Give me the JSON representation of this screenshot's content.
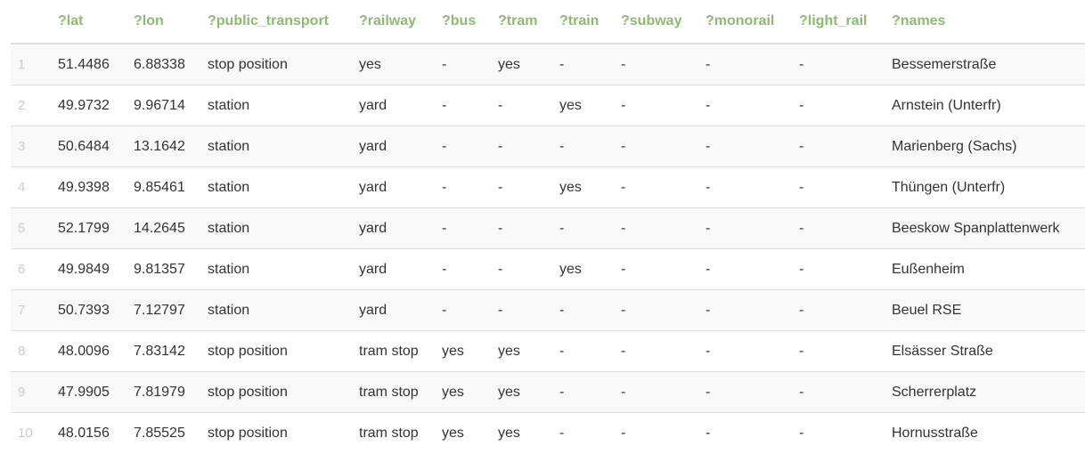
{
  "table": {
    "columns": [
      "",
      "?lat",
      "?lon",
      "?public_transport",
      "?railway",
      "?bus",
      "?tram",
      "?train",
      "?subway",
      "?monorail",
      "?light_rail",
      "?names"
    ],
    "rows": [
      [
        "1",
        "51.4486",
        "6.88338",
        "stop position",
        "yes",
        "-",
        "yes",
        "-",
        "-",
        "-",
        "-",
        "Bessemerstraße"
      ],
      [
        "2",
        "49.9732",
        "9.96714",
        "station",
        "yard",
        "-",
        "-",
        "yes",
        "-",
        "-",
        "-",
        "Arnstein (Unterfr)"
      ],
      [
        "3",
        "50.6484",
        "13.1642",
        "station",
        "yard",
        "-",
        "-",
        "-",
        "-",
        "-",
        "-",
        "Marienberg (Sachs)"
      ],
      [
        "4",
        "49.9398",
        "9.85461",
        "station",
        "yard",
        "-",
        "-",
        "yes",
        "-",
        "-",
        "-",
        "Thüngen (Unterfr)"
      ],
      [
        "5",
        "52.1799",
        "14.2645",
        "station",
        "yard",
        "-",
        "-",
        "-",
        "-",
        "-",
        "-",
        "Beeskow Spanplattenwerk"
      ],
      [
        "6",
        "49.9849",
        "9.81357",
        "station",
        "yard",
        "-",
        "-",
        "yes",
        "-",
        "-",
        "-",
        "Eußenheim"
      ],
      [
        "7",
        "50.7393",
        "7.12797",
        "station",
        "yard",
        "-",
        "-",
        "-",
        "-",
        "-",
        "-",
        "Beuel RSE"
      ],
      [
        "8",
        "48.0096",
        "7.83142",
        "stop position",
        "tram stop",
        "yes",
        "yes",
        "-",
        "-",
        "-",
        "-",
        "Elsässer Straße"
      ],
      [
        "9",
        "47.9905",
        "7.81979",
        "stop position",
        "tram stop",
        "yes",
        "yes",
        "-",
        "-",
        "-",
        "-",
        "Scherrerplatz"
      ],
      [
        "10",
        "48.0156",
        "7.85525",
        "stop position",
        "tram stop",
        "yes",
        "yes",
        "-",
        "-",
        "-",
        "-",
        "Hornusstraße"
      ]
    ]
  },
  "colors": {
    "header_text": "#8dbb72",
    "row_number": "#cccccc",
    "cell_text": "#333333",
    "stripe": "#f9f9f9"
  }
}
